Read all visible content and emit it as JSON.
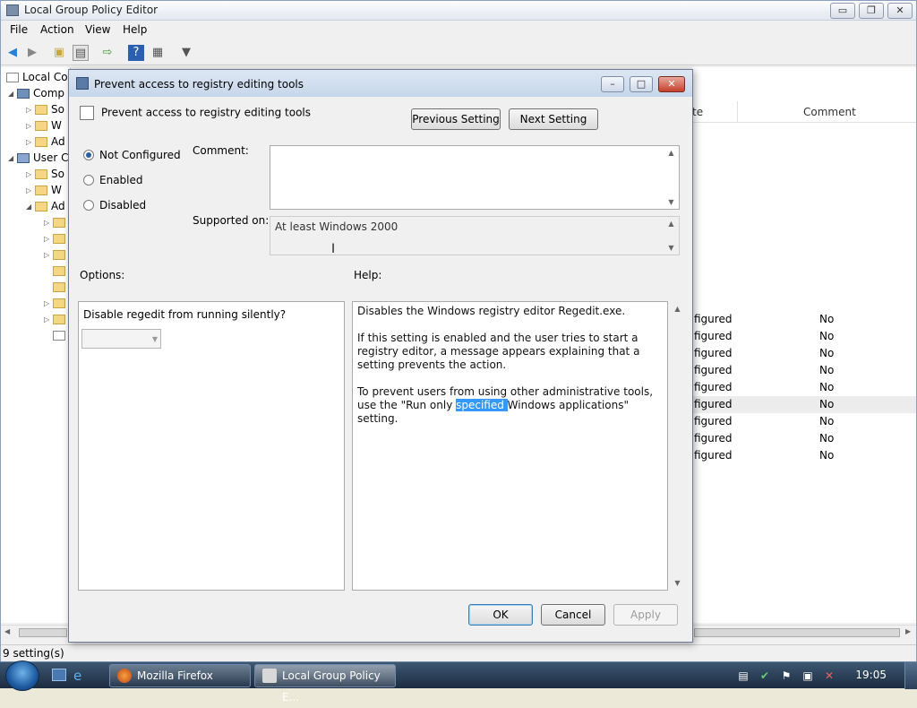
{
  "main_window": {
    "title": "Local Group Policy Editor",
    "controls": {
      "minimize": "▭",
      "restore": "❐",
      "close": "✕"
    }
  },
  "menu": [
    "File",
    "Action",
    "View",
    "Help"
  ],
  "toolbar_icons": [
    "back-icon",
    "forward-icon",
    "up-folder-icon",
    "show-hide-tree-icon",
    "export-list-icon",
    "help-icon",
    "properties-icon",
    "filter-icon"
  ],
  "tree": [
    {
      "label": "Local Com",
      "level": 0
    },
    {
      "label": "Comp",
      "level": 1
    },
    {
      "label": "So",
      "level": 2
    },
    {
      "label": "W",
      "level": 2
    },
    {
      "label": "Ad",
      "level": 2
    },
    {
      "label": "User C",
      "level": 1
    },
    {
      "label": "So",
      "level": 2
    },
    {
      "label": "W",
      "level": 2
    },
    {
      "label": "Ad",
      "level": 2
    }
  ],
  "list": {
    "headers": {
      "state": "te",
      "comment": "Comment"
    },
    "rows": [
      {
        "state": "figured",
        "comment": "No"
      },
      {
        "state": "figured",
        "comment": "No"
      },
      {
        "state": "figured",
        "comment": "No"
      },
      {
        "state": "figured",
        "comment": "No"
      },
      {
        "state": "figured",
        "comment": "No"
      },
      {
        "state": "figured",
        "comment": "No"
      },
      {
        "state": "figured",
        "comment": "No"
      },
      {
        "state": "figured",
        "comment": "No"
      },
      {
        "state": "figured",
        "comment": "No"
      }
    ]
  },
  "status": "9 setting(s)",
  "dialog": {
    "title": "Prevent access to registry editing tools",
    "heading": "Prevent access to registry editing tools",
    "prev_button": "Previous Setting",
    "next_button": "Next Setting",
    "radios": [
      {
        "label": "Not Configured",
        "checked": true
      },
      {
        "label": "Enabled",
        "checked": false
      },
      {
        "label": "Disabled",
        "checked": false
      }
    ],
    "comment_label": "Comment:",
    "comment_value": "",
    "supported_label": "Supported on:",
    "supported_value": "At least Windows 2000",
    "options_label": "Options:",
    "help_label": "Help:",
    "option_question": "Disable regedit from running silently?",
    "option_value": "",
    "help": {
      "p1": "Disables the Windows registry editor Regedit.exe.",
      "p2": "If this setting is enabled and the user tries to start a registry editor, a message appears explaining that a setting prevents the action.",
      "p3_before": "To prevent users from using other administrative tools, use the \"Run only ",
      "p3_highlight": "specified ",
      "p3_after": "Windows applications\" setting."
    },
    "ok": "OK",
    "cancel": "Cancel",
    "apply": "Apply"
  },
  "taskbar": {
    "tasks": [
      {
        "label": "Mozilla Firefox"
      },
      {
        "label": "Local Group Policy E..."
      }
    ],
    "clock": "19:05"
  }
}
